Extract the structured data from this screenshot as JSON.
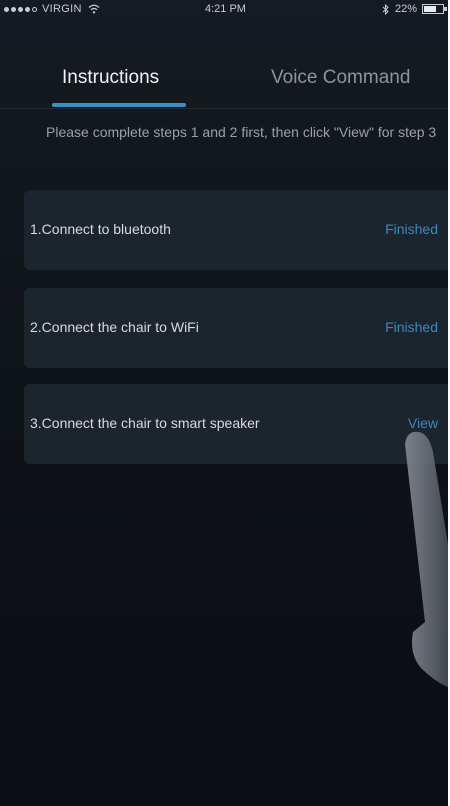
{
  "status_bar": {
    "carrier": "VIRGIN",
    "time": "4:21 PM",
    "battery": "22%"
  },
  "tabs": [
    {
      "label": "Instructions",
      "active": true
    },
    {
      "label": "Voice Command",
      "active": false
    }
  ],
  "instructions": "Please complete steps 1 and 2 first, then click \"View\" for step 3",
  "steps": [
    {
      "label": "1.Connect to bluetooth",
      "status": "Finished"
    },
    {
      "label": "2.Connect the chair to WiFi",
      "status": "Finished"
    },
    {
      "label": "3.Connect the chair to smart speaker",
      "status": "View"
    }
  ],
  "colors": {
    "accent": "#3a8fc4",
    "background": "#0f1419",
    "card": "#1c242d"
  }
}
